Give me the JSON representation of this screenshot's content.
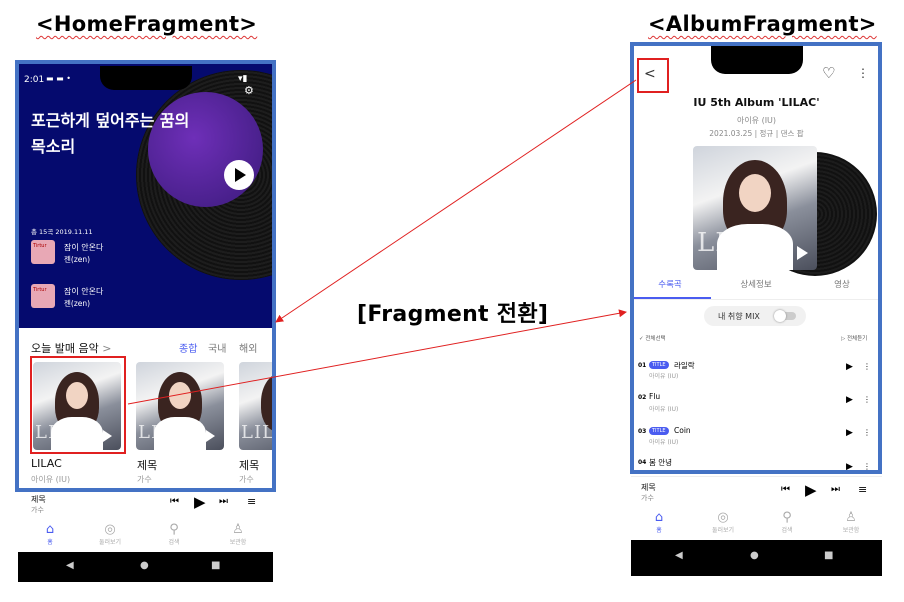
{
  "captions": {
    "home": "<HomeFragment>",
    "album": "<AlbumFragment>",
    "transition": "[Fragment 전환]"
  },
  "colors": {
    "accent": "#4a5cf0",
    "frame_blue": "#4472c4",
    "highlight_red": "#e02020",
    "home_bg": "#050a6e"
  },
  "home": {
    "status_time": "2:01",
    "headline_line1": "포근하게 덮어주는 꿈의",
    "headline_line2": "목소리",
    "track_meta": "총 15곡 2019.11.11",
    "tracks": [
      {
        "title": "잠이 안온다",
        "artist": "젠(zen)",
        "thumb_text": "Tirtur"
      },
      {
        "title": "잠이 안온다",
        "artist": "젠(zen)",
        "thumb_text": "Tirtur"
      }
    ],
    "section_title": "오늘 발매 음악",
    "section_chevron": ">",
    "filters": [
      "종합",
      "국내",
      "해외"
    ],
    "albums": [
      {
        "title": "LILAC",
        "artist": "아이유 (IU)"
      },
      {
        "title": "제목",
        "artist": "가수"
      },
      {
        "title": "제목",
        "artist": "가수"
      }
    ],
    "cover_text": "LILAC",
    "mini_player": {
      "title": "제목",
      "artist": "가수"
    },
    "nav": [
      {
        "label": "홈",
        "icon": "home-icon"
      },
      {
        "label": "둘러보기",
        "icon": "compass-icon"
      },
      {
        "label": "검색",
        "icon": "search-icon"
      },
      {
        "label": "보관함",
        "icon": "person-icon"
      }
    ]
  },
  "album": {
    "title": "IU 5th Album 'LILAC'",
    "artist": "아이유 (IU)",
    "meta": "2021.03.25 | 정규 | 댄스 팝",
    "cover_text": "LILAC",
    "tabs": [
      "수록곡",
      "상세정보",
      "영상"
    ],
    "mix_label": "내 취향 MIX",
    "select_all": "✓ 전체선택",
    "play_all": "▷ 전체듣기",
    "songs": [
      {
        "no": "01",
        "title_badge": "TITLE",
        "title": "라일락",
        "artist": "아이유 (IU)"
      },
      {
        "no": "02",
        "title_badge": "",
        "title": "Flu",
        "artist": "아이유 (IU)"
      },
      {
        "no": "03",
        "title_badge": "TITLE",
        "title": "Coin",
        "artist": "아이유 (IU)"
      },
      {
        "no": "04",
        "title_badge": "",
        "title": "봄 안녕",
        "artist": ""
      }
    ],
    "mini_player": {
      "title": "제목",
      "artist": "가수"
    },
    "nav": [
      {
        "label": "홈",
        "icon": "home-icon"
      },
      {
        "label": "둘러보기",
        "icon": "compass-icon"
      },
      {
        "label": "검색",
        "icon": "search-icon"
      },
      {
        "label": "보관함",
        "icon": "person-icon"
      }
    ]
  }
}
